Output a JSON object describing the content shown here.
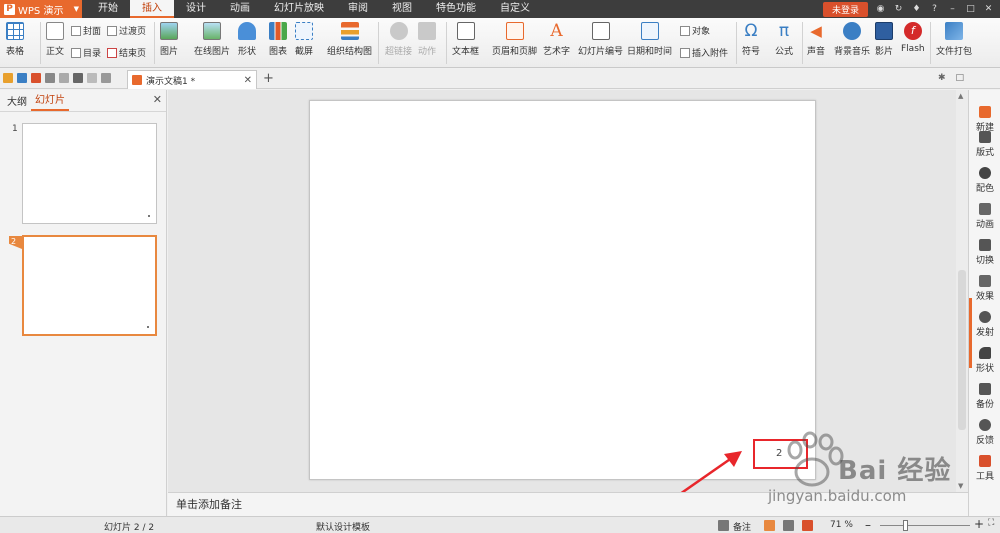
{
  "app": {
    "name": "WPS 演示"
  },
  "menu_tabs": [
    "开始",
    "插入",
    "设计",
    "动画",
    "幻灯片放映",
    "审阅",
    "视图",
    "特色功能",
    "自定义"
  ],
  "title_right": {
    "login": "未登录",
    "help": "?"
  },
  "ribbon": {
    "table": "表格",
    "body_text": "正文",
    "cover": "封面",
    "toc": "目录",
    "transition_page": "过渡页",
    "end_page": "结束页",
    "picture": "图片",
    "online_picture": "在线图片",
    "shape": "形状",
    "chart": "图表",
    "screenshot": "截屏",
    "org_chart": "组织结构图",
    "hyperlink": "超链接",
    "action": "动作",
    "textbox": "文本框",
    "header_footer": "页眉和页脚",
    "wordart": "艺术字",
    "slide_number": "幻灯片编号",
    "date_time": "日期和时间",
    "object": "对象",
    "attachment": "插入附件",
    "symbol": "符号",
    "formula": "公式",
    "sound": "声音",
    "bg_music": "背景音乐",
    "movie": "影片",
    "flash": "Flash",
    "package": "文件打包"
  },
  "doc_tab": {
    "title": "演示文稿1 *"
  },
  "left_panel": {
    "tab_outline": "大纲",
    "tab_slides": "幻灯片",
    "slides": [
      {
        "num": "1"
      },
      {
        "num": "2"
      }
    ]
  },
  "slide": {
    "page_number": "2"
  },
  "notes_placeholder": "单击添加备注",
  "right_pane": [
    "新建",
    "版式",
    "配色",
    "动画",
    "切换",
    "效果",
    "发射",
    "形状",
    "备份",
    "反馈",
    "工具"
  ],
  "status": {
    "slide_count": "幻灯片 2 / 2",
    "template": "默认设计模板",
    "notes": "备注",
    "zoom": "71 %"
  },
  "watermark": {
    "text": "Bai 经验",
    "url": "jingyan.baidu.com"
  },
  "colors": {
    "accent": "#e8692d",
    "highlight_box": "#e8262b",
    "login_btn": "#d9502c"
  }
}
